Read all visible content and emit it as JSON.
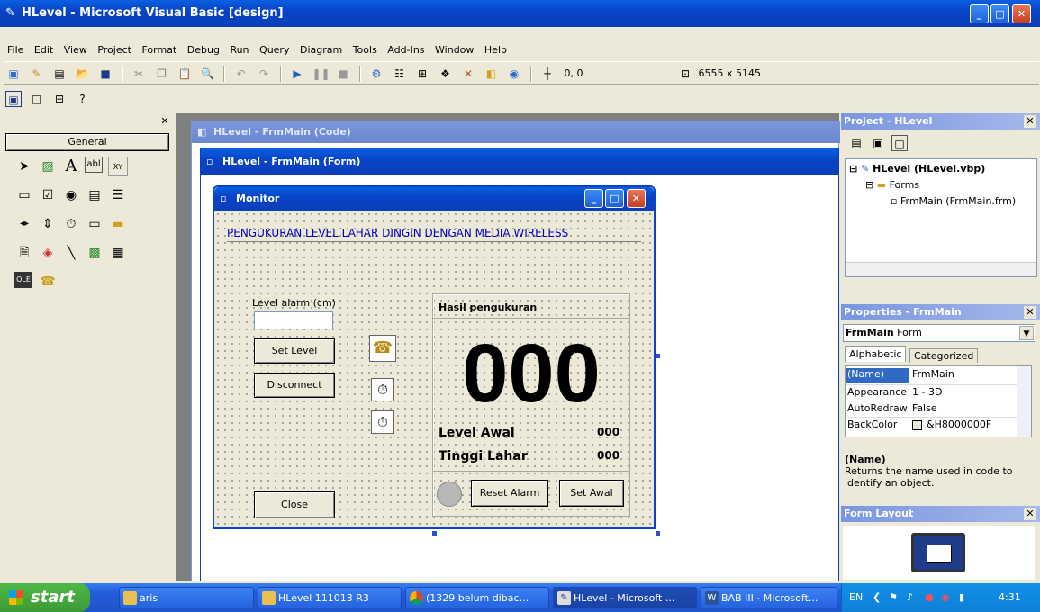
{
  "window": {
    "title": "HLevel - Microsoft Visual Basic [design]"
  },
  "menu": [
    "File",
    "Edit",
    "View",
    "Project",
    "Format",
    "Debug",
    "Run",
    "Query",
    "Diagram",
    "Tools",
    "Add-Ins",
    "Window",
    "Help"
  ],
  "toolbar": {
    "position": "0, 0",
    "size": "6555 x 5145"
  },
  "toolbox": {
    "header": "General"
  },
  "code_window": {
    "title": "HLevel - FrmMain (Code)"
  },
  "form_designer": {
    "title": "HLevel - FrmMain (Form)"
  },
  "monitor_form": {
    "title": "Monitor",
    "banner": "PENGUKURAN LEVEL LAHAR DINGIN DENGAN MEDIA WIRELESS",
    "level_alarm_label": "Level alarm (cm)",
    "set_level": "Set Level",
    "disconnect": "Disconnect",
    "close": "Close",
    "hasil_label": "Hasil pengukuran",
    "big_value": "000",
    "level_awal_label": "Level Awal",
    "level_awal_value": "000",
    "tinggi_lahar_label": "Tinggi Lahar",
    "tinggi_lahar_value": "000",
    "reset_alarm": "Reset Alarm",
    "set_awal": "Set Awal"
  },
  "project_panel": {
    "title": "Project - HLevel",
    "root": "HLevel (HLevel.vbp)",
    "folder": "Forms",
    "file": "FrmMain (FrmMain.frm)"
  },
  "properties_panel": {
    "title": "Properties - FrmMain",
    "object": "FrmMain",
    "object_type": "Form",
    "tab_alpha": "Alphabetic",
    "tab_cat": "Categorized",
    "rows": [
      {
        "name": "(Name)",
        "value": "FrmMain"
      },
      {
        "name": "Appearance",
        "value": "1 - 3D"
      },
      {
        "name": "AutoRedraw",
        "value": "False"
      },
      {
        "name": "BackColor",
        "value": "&H8000000F"
      }
    ],
    "desc_title": "(Name)",
    "desc_text": "Returns the name used in code to identify an object."
  },
  "layout_panel": {
    "title": "Form Layout"
  },
  "taskbar": {
    "start": "start",
    "items": [
      "aris",
      "HLevel 111013 R3",
      "(1329 belum dibac...",
      "HLevel - Microsoft ...",
      "BAB III - Microsoft..."
    ],
    "lang": "EN",
    "clock": "4:31"
  },
  "colors": {
    "xp_blue": "#0a5fe0",
    "form_text_blue": "#0000c0",
    "taskbar": "#245edb",
    "start_green": "#3c9a36"
  }
}
